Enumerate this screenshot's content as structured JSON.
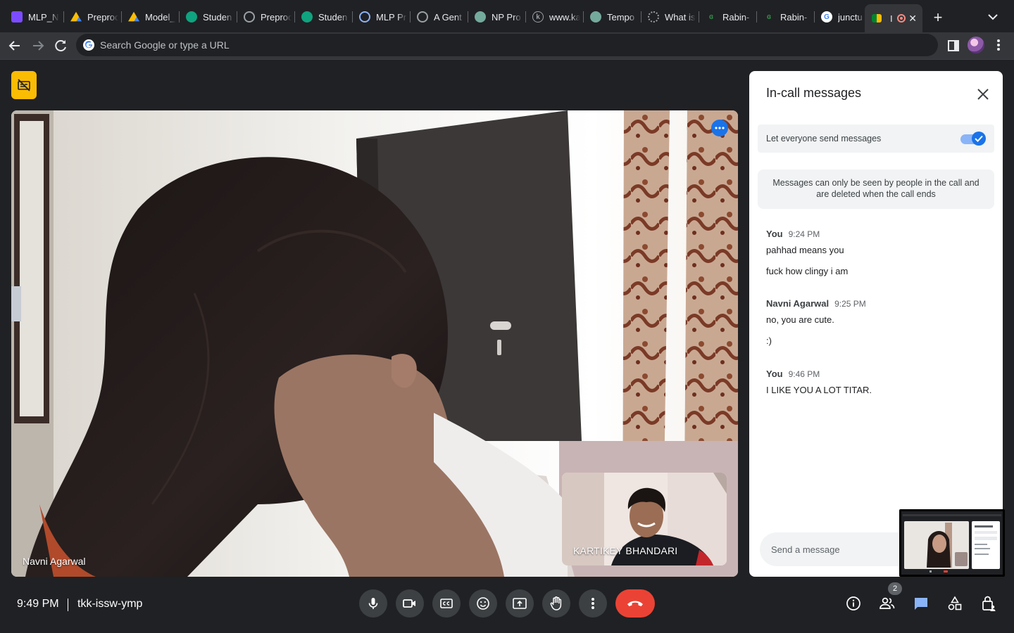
{
  "browser": {
    "tabs": [
      {
        "title": "MLP_N",
        "icon": "sheets-icon",
        "color": "#7b4cff"
      },
      {
        "title": "Preproc",
        "icon": "drive-icon",
        "color": "#fbbc04"
      },
      {
        "title": "Model_",
        "icon": "drive-icon",
        "color": "#fbbc04"
      },
      {
        "title": "Studen",
        "icon": "openai-icon",
        "color": "#10a37f"
      },
      {
        "title": "Preproc",
        "icon": "colab-icon",
        "color": "#9aa0a6"
      },
      {
        "title": "Studen",
        "icon": "openai-icon",
        "color": "#10a37f"
      },
      {
        "title": "MLP Pr",
        "icon": "site-icon",
        "color": "#8ab4f8"
      },
      {
        "title": "A Gent",
        "icon": "site-icon",
        "color": "#9aa0a6"
      },
      {
        "title": "NP Pro",
        "icon": "openai-icon",
        "color": "#74aa9c"
      },
      {
        "title": "www.ka",
        "icon": "kaggle-icon",
        "color": "#9aa0a6"
      },
      {
        "title": "Tempo",
        "icon": "openai-icon",
        "color": "#74aa9c"
      },
      {
        "title": "What is",
        "icon": "site-icon",
        "color": "#9aa0a6"
      },
      {
        "title": "Rabin-",
        "icon": "geeks-icon",
        "color": "#2f8d46"
      },
      {
        "title": "Rabin-",
        "icon": "geeks-icon",
        "color": "#2f8d46"
      },
      {
        "title": "junctu",
        "icon": "google-icon",
        "color": "#ffffff"
      }
    ],
    "active_tab": {
      "title": "I",
      "icon": "meet-icon"
    },
    "omnibox_placeholder": "Search Google or type a URL"
  },
  "meeting": {
    "time": "9:49 PM",
    "code": "tkk-issw-ymp",
    "main_participant": "Navni Agarwal",
    "self_participant": "KARTIKEY BHANDARI",
    "participant_count": "2"
  },
  "chat": {
    "title": "In-call messages",
    "toggle_label": "Let everyone send messages",
    "toggle_on": true,
    "notice": "Messages can only be seen by people in the call and are deleted when the call ends",
    "messages": [
      {
        "sender": "You",
        "time": "9:24 PM",
        "lines": [
          "pahhad means you",
          "fuck how clingy i am"
        ]
      },
      {
        "sender": "Navni Agarwal",
        "time": "9:25 PM",
        "lines": [
          "no, you are cute.",
          ":)"
        ]
      },
      {
        "sender": "You",
        "time": "9:46 PM",
        "lines": [
          "I LIKE YOU A LOT TITAR."
        ]
      }
    ],
    "input_placeholder": "Send a message"
  },
  "colors": {
    "meet_yellow": "#fbbc04",
    "end_call_red": "#ea4335",
    "accent_blue": "#1a73e8",
    "background": "#202124"
  }
}
